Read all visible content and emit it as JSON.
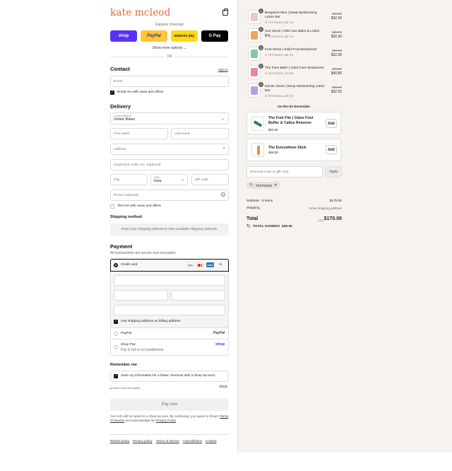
{
  "brand": {
    "logo": "kate mcleod"
  },
  "express": {
    "title": "Express checkout",
    "shop": "shop",
    "paypal": "PayPal",
    "amazon": "amazon pay",
    "gpay": "G Pay",
    "more": "Show more options",
    "or": "OR"
  },
  "contact": {
    "heading": "Contact",
    "signin": "Sign in",
    "email_placeholder": "Email",
    "newsletter": "Email me with news and offers"
  },
  "delivery": {
    "heading": "Delivery",
    "country_label": "Country/Region",
    "country": "United States",
    "first": "First name",
    "last": "Last name",
    "address": "Address",
    "apt": "Apartment, suite, etc. (optional)",
    "city": "City",
    "state_label": "State",
    "state": "Iowa",
    "zip": "ZIP code",
    "phone": "Phone (optional)",
    "text_offers": "Text me with news and offers"
  },
  "shipping": {
    "heading": "Shipping method",
    "note": "Enter your shipping address to view available shipping methods."
  },
  "payment": {
    "heading": "Payment",
    "sub": "All transactions are secure and encrypted.",
    "credit": "Credit card",
    "visa": "VISA",
    "mc": "MC",
    "amex": "AMEX",
    "more_cards": "+5",
    "billing": "Use shipping address as billing address",
    "paypal": "PayPal",
    "paypal_logo": "PayPal",
    "shoppay": "Shop Pay",
    "shoppay_sub": "Pay in full or in installments",
    "shoppay_logo": "shop"
  },
  "remember": {
    "heading": "Remember me",
    "save": "Save my information for a faster checkout with a Shop account",
    "secure": "Secure and encrypted",
    "shop": "shop"
  },
  "paynow": "Pay now",
  "legal": {
    "text1": "Your info will be saved to a Shop account. By continuing, you agree to Shop's",
    "terms": "Terms of Service",
    "and": "and acknowledge the",
    "privacy": "Privacy Policy"
  },
  "footer": [
    "Refund policy",
    "Privacy policy",
    "Terms of service",
    "Cancellations",
    "Contact"
  ],
  "cart": {
    "items": [
      {
        "qty": "1",
        "title": "Bergamot Mint | Deep Moisturizing Lotion Bar",
        "disc": "TEXTKM15 (-$5.70)",
        "old": "$38.00",
        "price": "$32.30",
        "color": "#e8c9c0"
      },
      {
        "qty": "1",
        "title": "Sun Stone | After Sun Balm & Lotion Bar",
        "disc": "TEXTKM15 (-$5.70)",
        "old": "$38.00",
        "price": "$32.30",
        "color": "#f0a35a"
      },
      {
        "qty": "1",
        "title": "Foot Stone | Solid Foot Moisturizer",
        "disc": "TEXTKM15 (-$5.70)",
        "old": "$38.00",
        "price": "$32.30",
        "color": "#7fc9a8"
      },
      {
        "qty": "1",
        "title": "The Face Balm | Solid Face Moisturizer",
        "disc": "TEXTKM15 (-$7.20)",
        "old": "$48.00",
        "price": "$40.80",
        "color": "#e98aa0"
      },
      {
        "qty": "1",
        "title": "Nectar Stone | Deep Moisturizing Lotion Bar",
        "disc": "TEXTKM15 (-$5.70)",
        "old": "$38.00",
        "price": "$32.30",
        "color": "#b7a0d8"
      }
    ],
    "essentials_heading": "On-the-Go Essentials",
    "upsell": [
      {
        "title": "The Foot File | Glass Foot Buffer & Callus Remover",
        "price": "$20.00",
        "add": "Add"
      },
      {
        "title": "The Everywhere Stick",
        "price": "$28.00",
        "add": "Add"
      }
    ],
    "discount_placeholder": "Discount code or gift card",
    "apply": "Apply",
    "code": "TEXTKM15",
    "subtotal_label": "Subtotal · 5 items",
    "subtotal": "$170.00",
    "shipping_label": "Shipping",
    "shipping": "Enter shipping address",
    "total_label": "Total",
    "currency": "USD",
    "total": "$170.00",
    "savings_label": "TOTAL SAVINGS",
    "savings": "$30.00"
  }
}
